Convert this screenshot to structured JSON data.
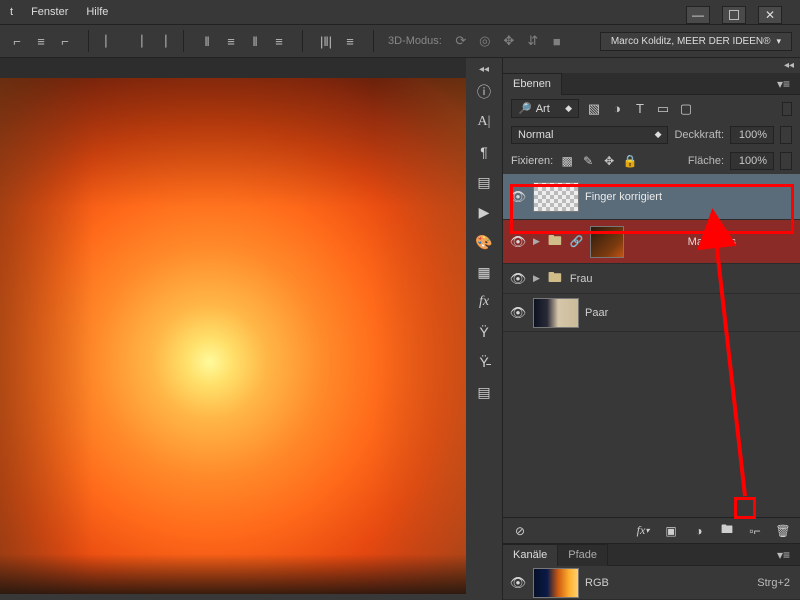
{
  "menu": {
    "items": [
      "t",
      "Fenster",
      "Hilfe"
    ]
  },
  "workspace_label": "Marco Kolditz, MEER DER IDEEN®",
  "mode3d_label": "3D-Modus:",
  "layers": {
    "tab": "Ebenen",
    "kind_label": "Art",
    "blend_mode": "Normal",
    "opacity_label": "Deckkraft:",
    "opacity_value": "100%",
    "lock_label": "Fixieren:",
    "fill_label": "Fläche:",
    "fill_value": "100%",
    "items": [
      {
        "name": "Finger korrigiert",
        "selected": true,
        "thumb": "transp",
        "kind": "layer"
      },
      {
        "name": "Mann aus",
        "selected": false,
        "thumb": "dark",
        "kind": "group",
        "linked": true
      },
      {
        "name": "Frau",
        "selected": false,
        "thumb": "empty",
        "kind": "group"
      },
      {
        "name": "Paar",
        "selected": false,
        "thumb": "couple",
        "kind": "layer"
      }
    ]
  },
  "channels": {
    "tab_channels": "Kanäle",
    "tab_paths": "Pfade",
    "items": [
      {
        "name": "RGB",
        "shortcut": "Strg+2",
        "thumb": "flame"
      }
    ]
  }
}
